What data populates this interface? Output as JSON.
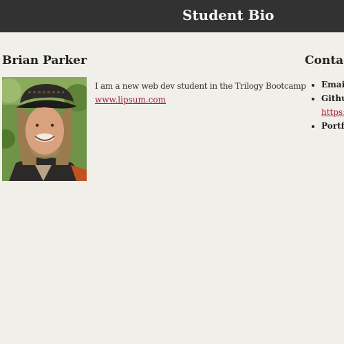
{
  "header": {
    "title": "Student Bio"
  },
  "profile": {
    "name": "Brian Parker",
    "bio": "I am a new web dev student in the Trilogy Bootcamp",
    "link": "www.lipsum.com"
  },
  "contact": {
    "heading": "Contact",
    "items": [
      {
        "label": "Email"
      },
      {
        "label": "Githu",
        "link": "https:/"
      },
      {
        "label": "Portfo"
      }
    ]
  },
  "colors": {
    "header_bg": "#323232",
    "page_bg": "#f0efe9",
    "link": "#a0223a"
  }
}
